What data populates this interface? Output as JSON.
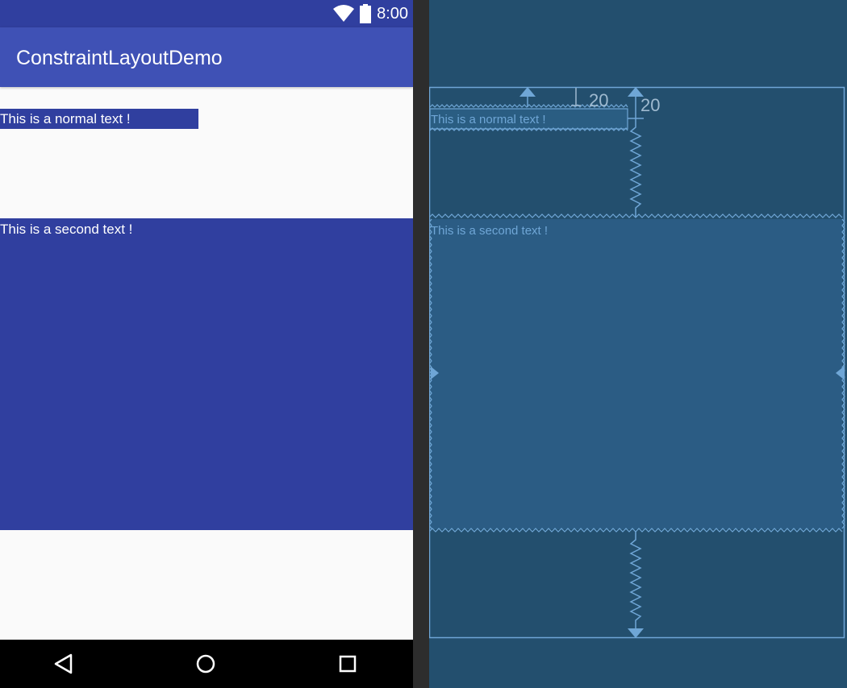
{
  "status_bar": {
    "time": "8:00",
    "icons": [
      "wifi-icon",
      "battery-icon"
    ]
  },
  "app_bar": {
    "title": "ConstraintLayoutDemo"
  },
  "content": {
    "normal_text": "This is a normal text !",
    "second_text": "This is a second text !"
  },
  "nav_bar": {
    "icons": [
      "back-icon",
      "home-icon",
      "recents-icon"
    ]
  },
  "blueprint": {
    "normal_text": "This is a normal text !",
    "second_text": "This is a second text !",
    "margin_left": "20",
    "margin_top": "20"
  },
  "colors": {
    "primary": "#3f51b5",
    "primary_dark": "#303f9f",
    "blueprint_bg": "#234f6e",
    "blueprint_line": "#6fa6d6"
  }
}
